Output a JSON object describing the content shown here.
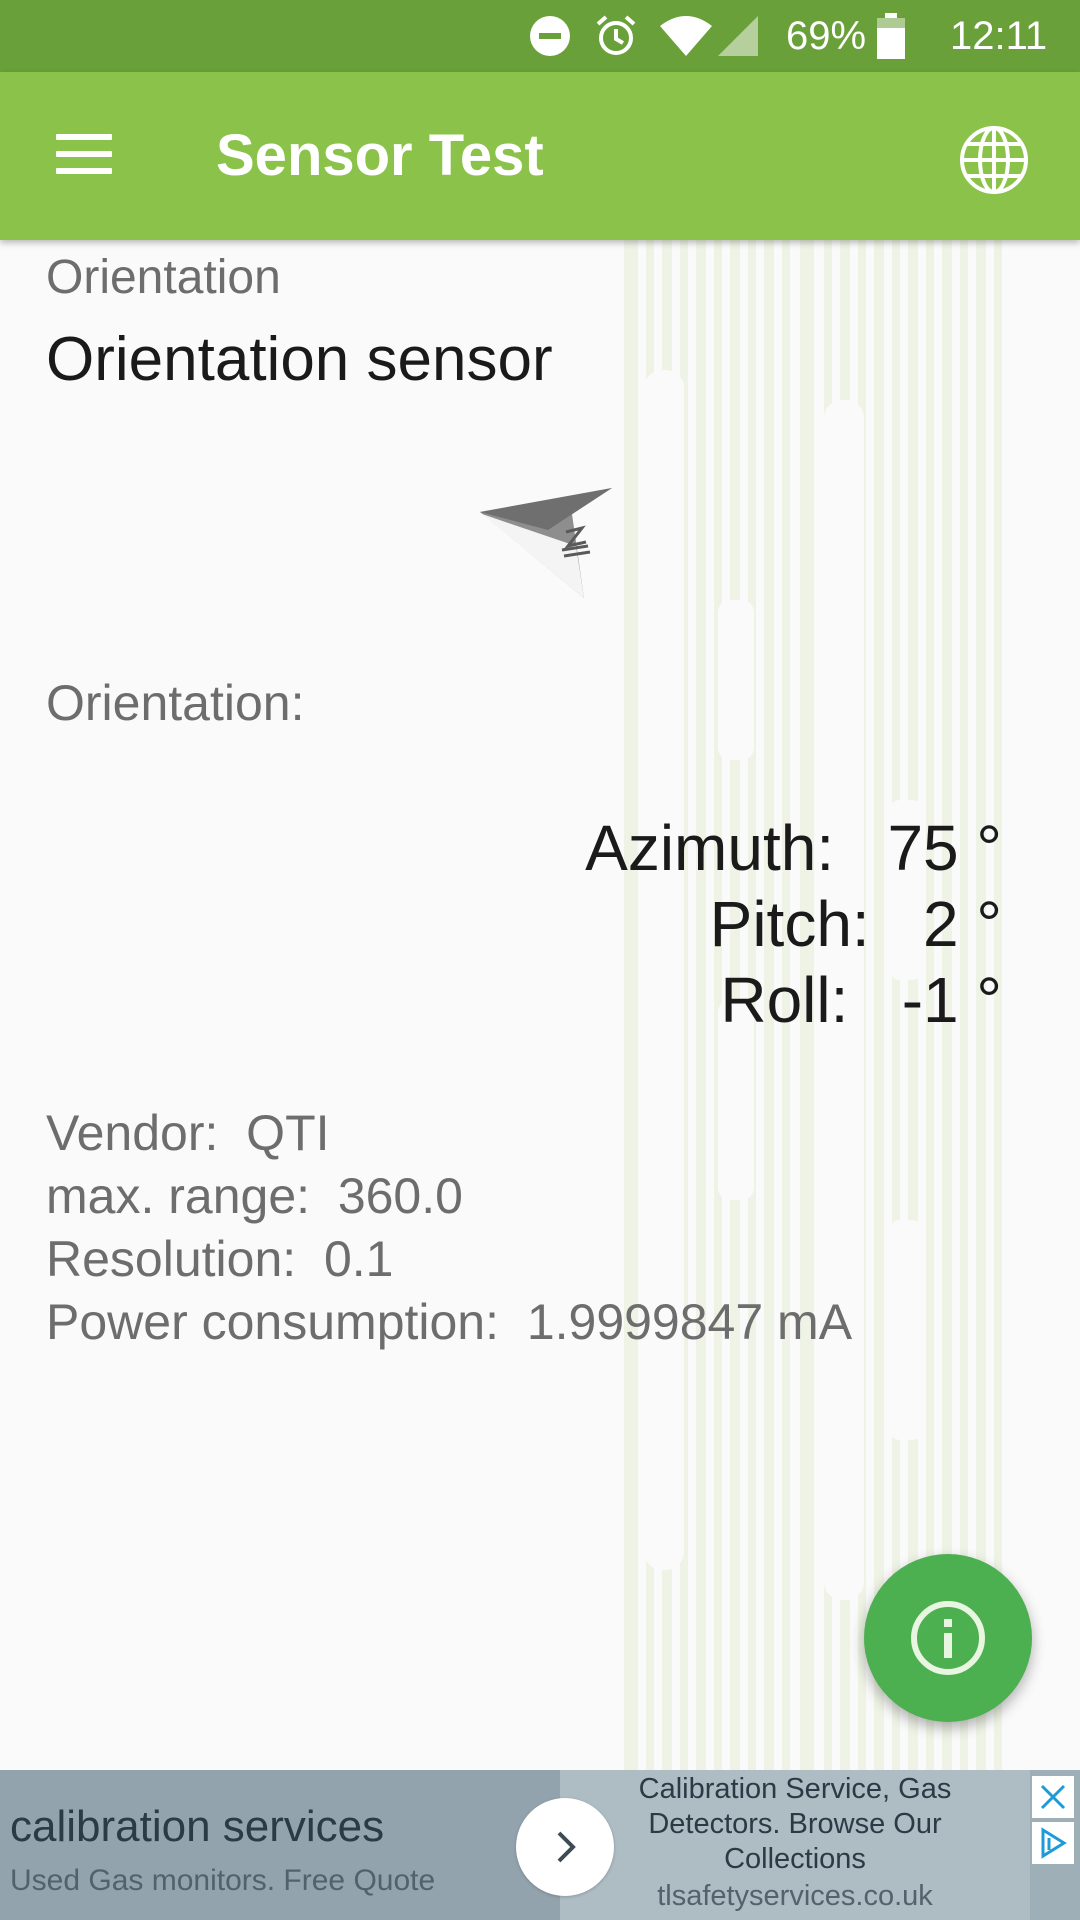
{
  "status_bar": {
    "battery_percent": "69%",
    "time": "12:11",
    "icons": [
      "do-not-disturb-icon",
      "alarm-icon",
      "wifi-icon",
      "cellular-signal-icon",
      "battery-icon"
    ]
  },
  "app_bar": {
    "title": "Sensor Test",
    "menu_icon": "hamburger-menu-icon",
    "action_icon": "globe-icon"
  },
  "sensor": {
    "category": "Orientation",
    "name": "Orientation sensor",
    "section_label": "Orientation:",
    "readings": [
      {
        "label": "Azimuth:",
        "value": "75 °"
      },
      {
        "label": "Pitch:",
        "value": "2 °"
      },
      {
        "label": "Roll:",
        "value": "-1 °"
      }
    ],
    "specs": [
      {
        "label": "Vendor:",
        "value": "QTI"
      },
      {
        "label": "max. range:",
        "value": "360.0"
      },
      {
        "label": "Resolution:",
        "value": "0.1"
      },
      {
        "label": "Power consumption:",
        "value": "1.9999847 mA"
      }
    ]
  },
  "fab": {
    "icon": "info-icon"
  },
  "ad": {
    "headline": "calibration services",
    "subline": "Used Gas monitors. Free Quote",
    "description_lines": [
      "Calibration Service, Gas",
      "Detectors. Browse Our",
      "Collections"
    ],
    "domain": "tlsafetyservices.co.uk"
  },
  "colors": {
    "status_bar": "#6aa03a",
    "app_bar": "#8bc34a",
    "fab": "#4caf50",
    "background": "#fafafa"
  }
}
